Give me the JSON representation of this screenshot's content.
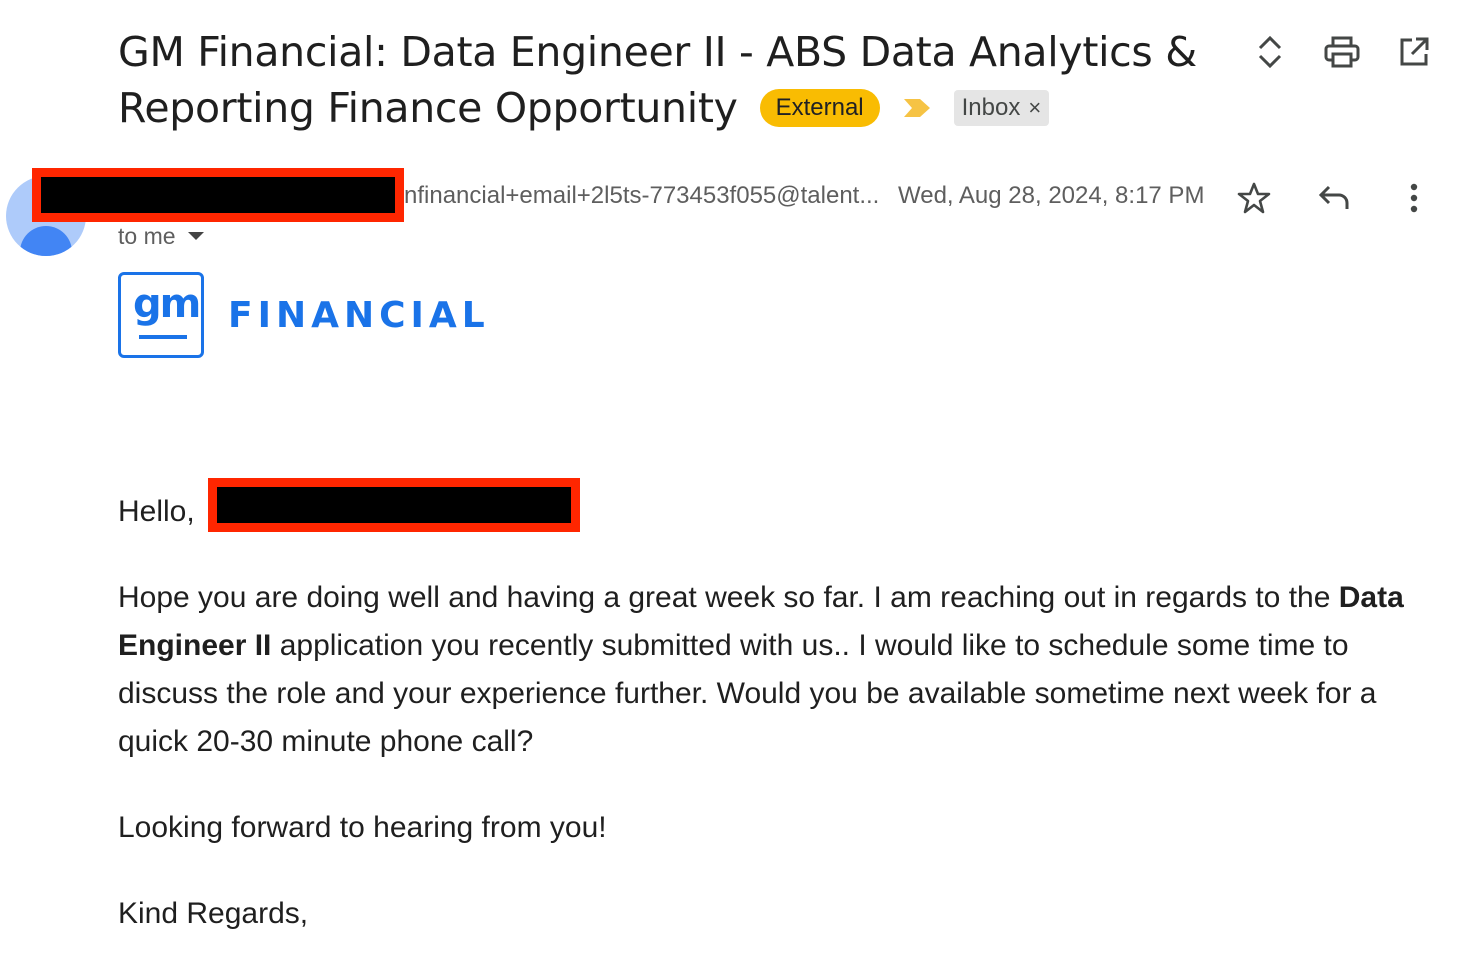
{
  "subject": {
    "line1": "GM Financial: Data Engineer II - ABS Data Analytics &",
    "line2": "Reporting Finance Opportunity",
    "labels": {
      "external": "External",
      "inbox": "Inbox",
      "inbox_remove": "×"
    }
  },
  "toolbar": {
    "icons": [
      "expand-collapse-icon",
      "print-icon",
      "open-in-new-window-icon"
    ]
  },
  "message": {
    "sender_email": "nfinancial+email+2l5ts-773453f055@talent...",
    "date": "Wed, Aug 28, 2024, 8:17 PM",
    "recipient": "to me",
    "actions": [
      "star-icon",
      "reply-icon",
      "more-options-icon"
    ]
  },
  "logo": {
    "mark": "gm",
    "wordmark": "FINANCIAL"
  },
  "body": {
    "greeting": "Hello,",
    "para1_pre": "Hope you are doing well and having a great week so far. I am reaching out in regards to the ",
    "para1_bold": "Data Engineer II",
    "para1_post": " application you recently submitted with us.. I would like to schedule some time to discuss the role and your experience further. Would you be available sometime next week for a quick 20-30 minute phone call?",
    "para2": "Looking forward to hearing from you!",
    "closing": "Kind Regards,"
  },
  "colors": {
    "external_label": "#f9bc02",
    "importance": "#f6c344",
    "redaction_border": "#ff2600",
    "brand_blue": "#1a73e8"
  }
}
